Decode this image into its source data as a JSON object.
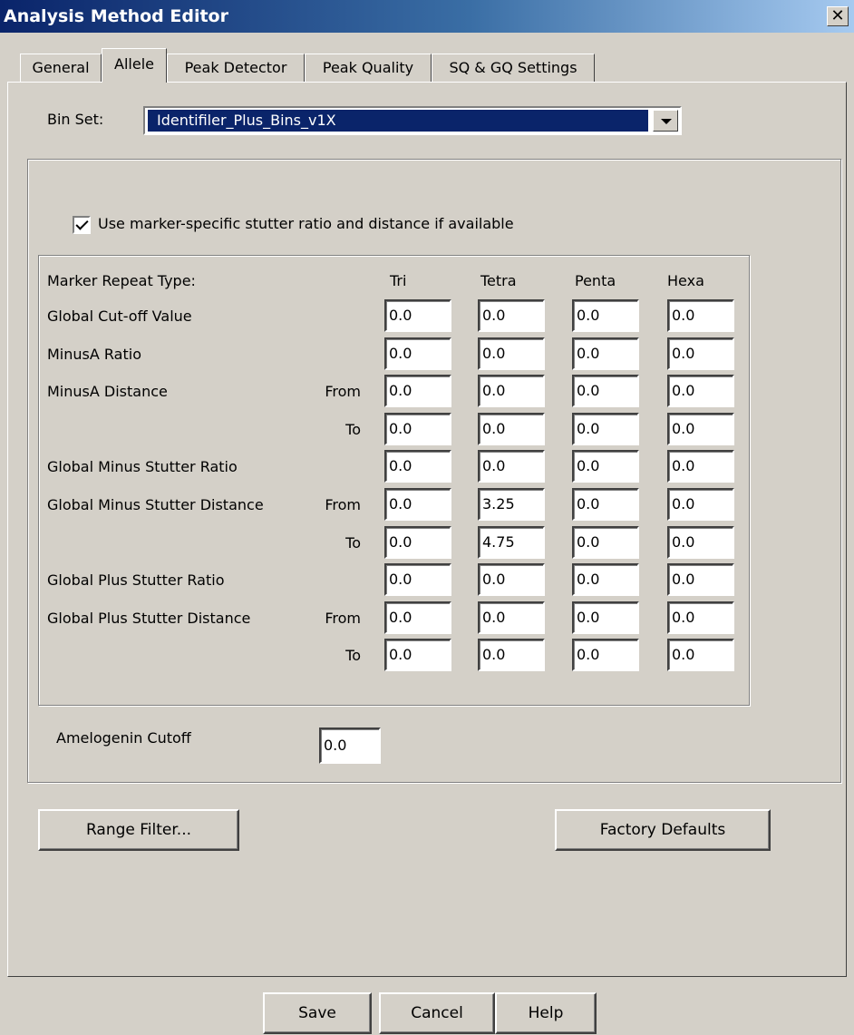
{
  "window": {
    "title": "Analysis Method Editor",
    "close_glyph": "✕"
  },
  "tabs": [
    "General",
    "Allele",
    "Peak Detector",
    "Peak Quality",
    "SQ & GQ Settings"
  ],
  "active_tab": "Allele",
  "bin_set": {
    "label": "Bin Set:",
    "value": "Identifiler_Plus_Bins_v1X"
  },
  "checkbox": {
    "label": "Use marker-specific stutter ratio and distance if available",
    "checked": true
  },
  "grid": {
    "header_label": "Marker Repeat Type:",
    "columns": [
      "Tri",
      "Tetra",
      "Penta",
      "Hexa"
    ],
    "rows": [
      {
        "label": "Global Cut-off Value",
        "sub": "",
        "values": [
          "0.0",
          "0.0",
          "0.0",
          "0.0"
        ]
      },
      {
        "label": "MinusA Ratio",
        "sub": "",
        "values": [
          "0.0",
          "0.0",
          "0.0",
          "0.0"
        ]
      },
      {
        "label": "MinusA Distance",
        "sub": "From",
        "values": [
          "0.0",
          "0.0",
          "0.0",
          "0.0"
        ]
      },
      {
        "label": "",
        "sub": "To",
        "values": [
          "0.0",
          "0.0",
          "0.0",
          "0.0"
        ]
      },
      {
        "label": "Global Minus Stutter Ratio",
        "sub": "",
        "values": [
          "0.0",
          "0.0",
          "0.0",
          "0.0"
        ]
      },
      {
        "label": "Global Minus Stutter Distance",
        "sub": "From",
        "values": [
          "0.0",
          "3.25",
          "0.0",
          "0.0"
        ]
      },
      {
        "label": "",
        "sub": "To",
        "values": [
          "0.0",
          "4.75",
          "0.0",
          "0.0"
        ]
      },
      {
        "label": "Global Plus Stutter Ratio",
        "sub": "",
        "values": [
          "0.0",
          "0.0",
          "0.0",
          "0.0"
        ]
      },
      {
        "label": "Global Plus Stutter Distance",
        "sub": "From",
        "values": [
          "0.0",
          "0.0",
          "0.0",
          "0.0"
        ]
      },
      {
        "label": "",
        "sub": "To",
        "values": [
          "0.0",
          "0.0",
          "0.0",
          "0.0"
        ]
      }
    ]
  },
  "amelogenin": {
    "label": "Amelogenin Cutoff",
    "value": "0.0"
  },
  "buttons": {
    "range_filter": "Range Filter...",
    "factory_defaults": "Factory Defaults",
    "save": "Save",
    "cancel": "Cancel",
    "help": "Help"
  }
}
